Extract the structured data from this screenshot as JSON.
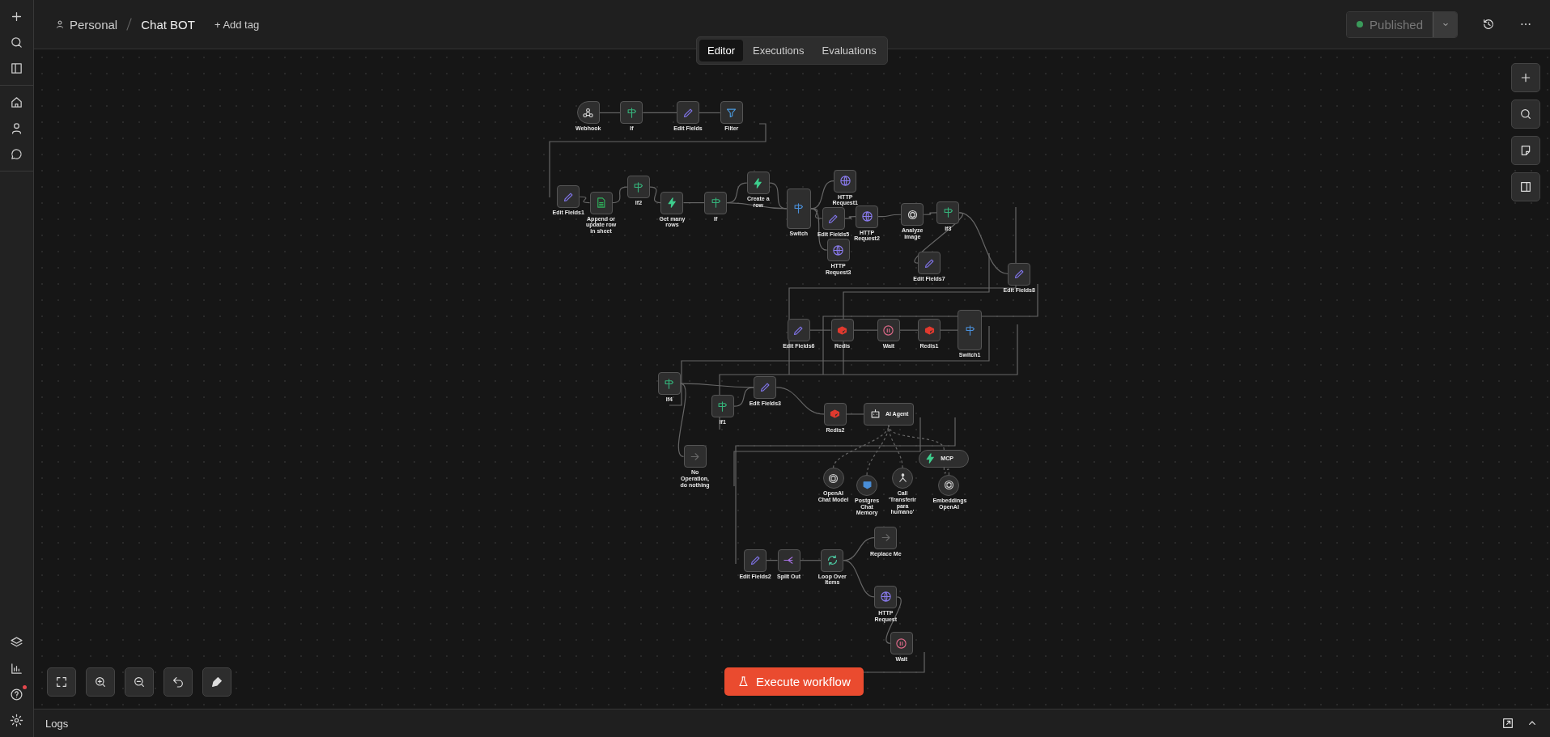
{
  "breadcrumb": {
    "project": "Personal",
    "workflow": "Chat BOT"
  },
  "add_tag": "+ Add tag",
  "tabs": [
    {
      "label": "Editor",
      "selected": true
    },
    {
      "label": "Executions",
      "selected": false
    },
    {
      "label": "Evaluations",
      "selected": false
    }
  ],
  "publish": {
    "label": "Published",
    "published": true
  },
  "sidebar": {
    "help_notification": true
  },
  "nodes": [
    {
      "name": "Webhook",
      "kind": "trigger"
    },
    {
      "name": "If",
      "kind": "if"
    },
    {
      "name": "Edit Fields",
      "kind": "edit"
    },
    {
      "name": "Filter",
      "kind": "filter"
    },
    {
      "name": "Edit Fields1",
      "kind": "edit"
    },
    {
      "name": "Append or update row in sheet",
      "kind": "sheets"
    },
    {
      "name": "If2",
      "kind": "if"
    },
    {
      "name": "Get many rows",
      "kind": "bolt"
    },
    {
      "name": "If",
      "kind": "if"
    },
    {
      "name": "Create a row",
      "kind": "bolt"
    },
    {
      "name": "Switch",
      "kind": "switch"
    },
    {
      "name": "HTTP Request1",
      "kind": "http"
    },
    {
      "name": "Edit Fields5",
      "kind": "edit"
    },
    {
      "name": "HTTP Request2",
      "kind": "http"
    },
    {
      "name": "Analyze image",
      "kind": "openai"
    },
    {
      "name": "If3",
      "kind": "if"
    },
    {
      "name": "HTTP Request3",
      "kind": "http"
    },
    {
      "name": "Edit Fields7",
      "kind": "edit"
    },
    {
      "name": "Edit Fields8",
      "kind": "edit"
    },
    {
      "name": "Edit Fields6",
      "kind": "edit"
    },
    {
      "name": "Redis",
      "kind": "redis"
    },
    {
      "name": "Wait",
      "kind": "wait"
    },
    {
      "name": "Redis1",
      "kind": "redis"
    },
    {
      "name": "Switch1",
      "kind": "switch"
    },
    {
      "name": "If4",
      "kind": "if"
    },
    {
      "name": "If1",
      "kind": "if"
    },
    {
      "name": "Edit Fields3",
      "kind": "edit"
    },
    {
      "name": "Redis2",
      "kind": "redis"
    },
    {
      "name": "AI Agent",
      "kind": "agent"
    },
    {
      "name": "No Operation, do nothing",
      "kind": "noop"
    },
    {
      "name": "OpenAI Chat Model",
      "kind": "model"
    },
    {
      "name": "Postgres Chat Memory",
      "kind": "memory"
    },
    {
      "name": "Call 'Transferir para humano'",
      "kind": "tool"
    },
    {
      "name": "MCP",
      "kind": "mcp"
    },
    {
      "name": "Embeddings OpenAI",
      "kind": "model"
    },
    {
      "name": "Edit Fields2",
      "kind": "edit"
    },
    {
      "name": "Split Out",
      "kind": "split"
    },
    {
      "name": "Loop Over Items",
      "kind": "loop"
    },
    {
      "name": "Replace Me",
      "kind": "noop"
    },
    {
      "name": "HTTP Request",
      "kind": "http"
    },
    {
      "name": "Wait",
      "kind": "wait"
    }
  ],
  "execute_button": "Execute workflow",
  "logs": {
    "label": "Logs"
  }
}
